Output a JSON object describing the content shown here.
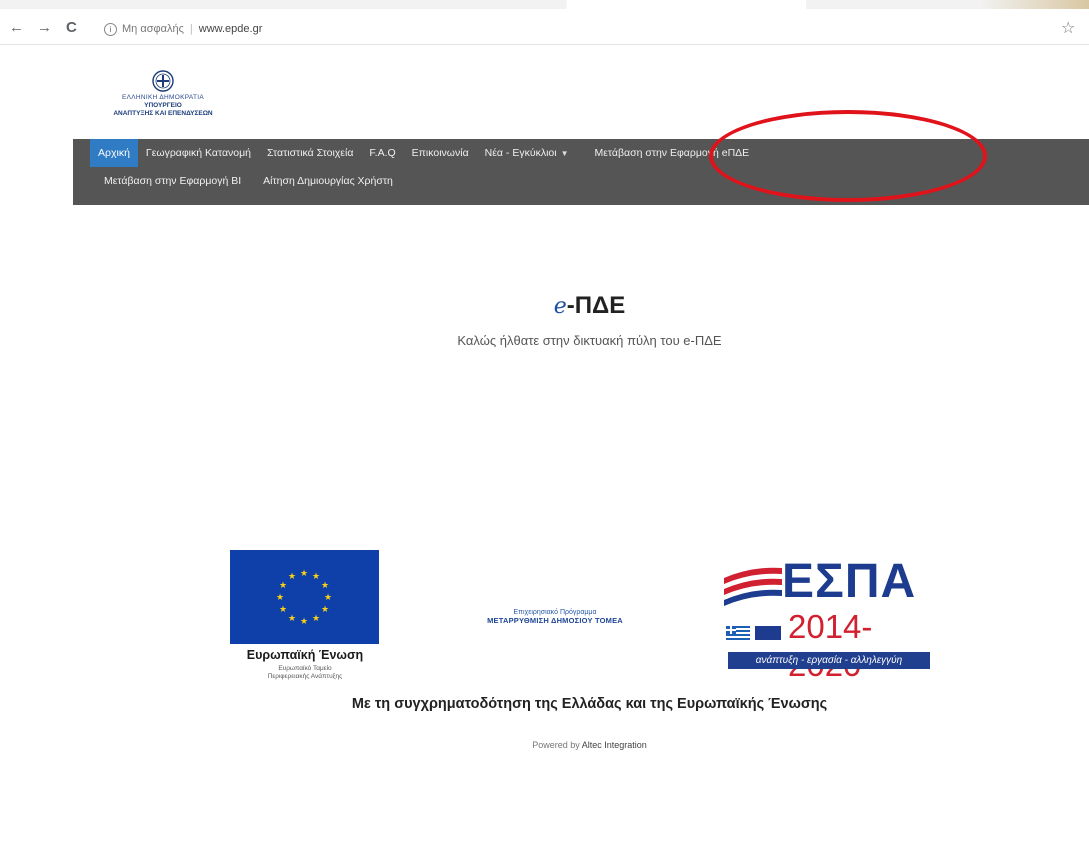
{
  "browser": {
    "back_glyph": "←",
    "forward_glyph": "→",
    "reload_glyph": "C",
    "security_text": "Μη ασφαλής",
    "url": "www.epde.gr",
    "star_glyph": "☆",
    "info_glyph": "i",
    "separator": "|"
  },
  "header": {
    "logo": {
      "line1": "ΕΛΛΗΝΙΚΗ ΔΗΜΟΚΡΑΤΙΑ",
      "line2": "ΥΠΟΥΡΓΕΙΟ",
      "line3": "ΑΝΑΠΤΥΞΗΣ ΚΑΙ ΕΠΕΝΔΥΣΕΩΝ"
    },
    "nav_row1": [
      {
        "label": "Αρχική",
        "active": true
      },
      {
        "label": "Γεωγραφική Κατανομή"
      },
      {
        "label": "Στατιστικά Στοιχεία"
      },
      {
        "label": "F.A.Q"
      },
      {
        "label": "Επικοινωνία"
      },
      {
        "label": "Νέα - Εγκύκλιοι"
      },
      {
        "label": "Μετάβαση στην Εφαρμογή eΠΔΕ"
      }
    ],
    "nav_row2": [
      {
        "label": "Μετάβαση στην Εφαρμογή BI"
      },
      {
        "label": "Αίτηση Δημιουργίας Χρήστη"
      }
    ],
    "caret_glyph": "▼",
    "highlight_color": "#e0131b",
    "nav_bg": "#555555",
    "active_bg": "#2f7bc4"
  },
  "hero": {
    "title_prefix": "e",
    "title_main": "-ΠΔΕ",
    "subtitle": "Καλώς ήλθατε στην δικτυακή πύλη του e-ΠΔΕ"
  },
  "funding": {
    "eu_label": "Ευρωπαϊκή Ένωση",
    "eu_fund_line1": "Ευρωπαϊκό Ταμείο",
    "eu_fund_line2": "Περιφερειακής Ανάπτυξης",
    "program_line1": "Επιχειρησιακό Πρόγραμμα",
    "program_line2": "ΜΕΤΑΡΡΥΘΜΙΣΗ ΔΗΜΟΣΙΟΥ ΤΟΜΕΑ",
    "espa_word": "ΕΣΠΑ",
    "espa_years": "2014-2020",
    "espa_tagline": "ανάπτυξη - εργασία - αλληλεγγύη",
    "cofund": "Με τη συγχρηματοδότηση της Ελλάδας και της Ευρωπαϊκής Ένωσης"
  },
  "footer": {
    "powered_by": "Powered by",
    "company": "Altec Integration"
  }
}
